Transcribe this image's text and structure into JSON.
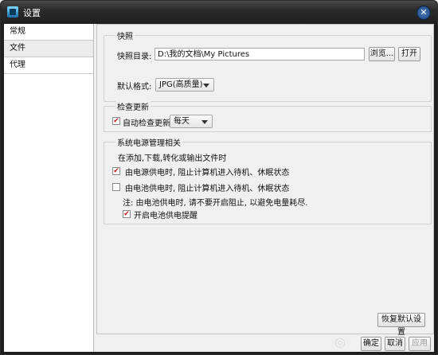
{
  "window": {
    "title": "设置",
    "close_symbol": "✕"
  },
  "nav": {
    "items": [
      "常规",
      "文件",
      "代理"
    ],
    "active_index": 1
  },
  "snapshot": {
    "legend": "快照",
    "dir_label": "快照目录:",
    "dir_value": "D:\\我的文档\\My Pictures",
    "browse_label": "浏览...",
    "open_label": "打开",
    "format_label": "默认格式:",
    "format_value": "JPG(高质量)"
  },
  "update": {
    "legend": "检查更新",
    "auto_label": "自动检查更新:",
    "auto_checked": true,
    "frequency_value": "每天"
  },
  "power": {
    "legend": "系统电源管理相关",
    "intro": "在添加,下载,转化或输出文件时",
    "option_ac": "由电源供电时, 阻止计算机进入待机、休眠状态",
    "option_ac_checked": true,
    "option_battery": "由电池供电时, 阻止计算机进入待机、休眠状态",
    "option_battery_checked": false,
    "note": "注: 由电池供电时, 请不要开启阻止, 以避免电量耗尽.",
    "battery_reminder": "开启电池供电提醒",
    "battery_reminder_checked": true
  },
  "footer": {
    "restore_label": "恢复默认设置",
    "ok_label": "确定",
    "cancel_label": "取消",
    "apply_label": "应用"
  }
}
